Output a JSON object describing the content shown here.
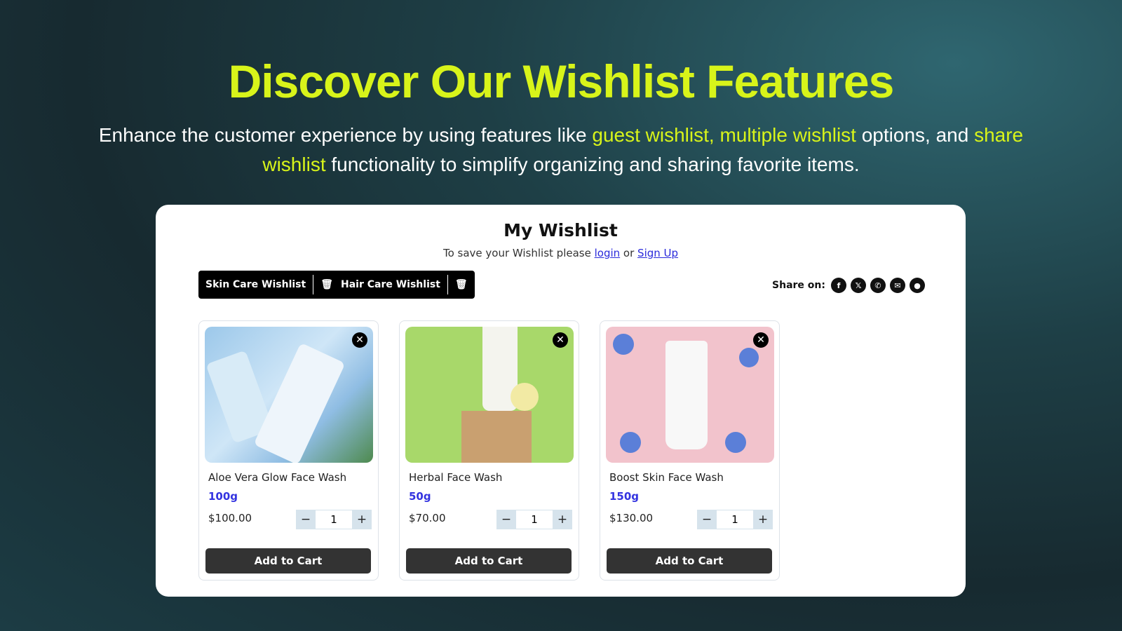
{
  "hero": {
    "title": "Discover Our Wishlist Features",
    "sub_1": "Enhance the customer experience by using features like ",
    "sub_hl1": "guest wishlist, multiple wishlist",
    "sub_2": " options, and ",
    "sub_hl2": "share wishlist",
    "sub_3": " functionality to simplify organizing and sharing favorite items.",
    "accent": "#d8f41a"
  },
  "wishlist": {
    "title": "My Wishlist",
    "save_text": "To save your Wishlist please ",
    "login": "login",
    "or": " or ",
    "signup": "Sign Up",
    "lists": [
      {
        "label": "Skin Care Wishlist"
      },
      {
        "label": "Hair Care Wishlist"
      }
    ],
    "share_label": "Share on:",
    "share_icons": [
      "facebook-icon",
      "x-icon",
      "whatsapp-icon",
      "email-icon",
      "chat-icon"
    ],
    "products": [
      {
        "name": "Aloe Vera Glow Face Wash",
        "size": "100g",
        "price": "$100.00",
        "qty": "1",
        "cta": "Add to Cart"
      },
      {
        "name": "Herbal Face Wash",
        "size": "50g",
        "price": "$70.00",
        "qty": "1",
        "cta": "Add to Cart"
      },
      {
        "name": "Boost Skin Face Wash",
        "size": "150g",
        "price": "$130.00",
        "qty": "1",
        "cta": "Add to Cart"
      }
    ]
  }
}
